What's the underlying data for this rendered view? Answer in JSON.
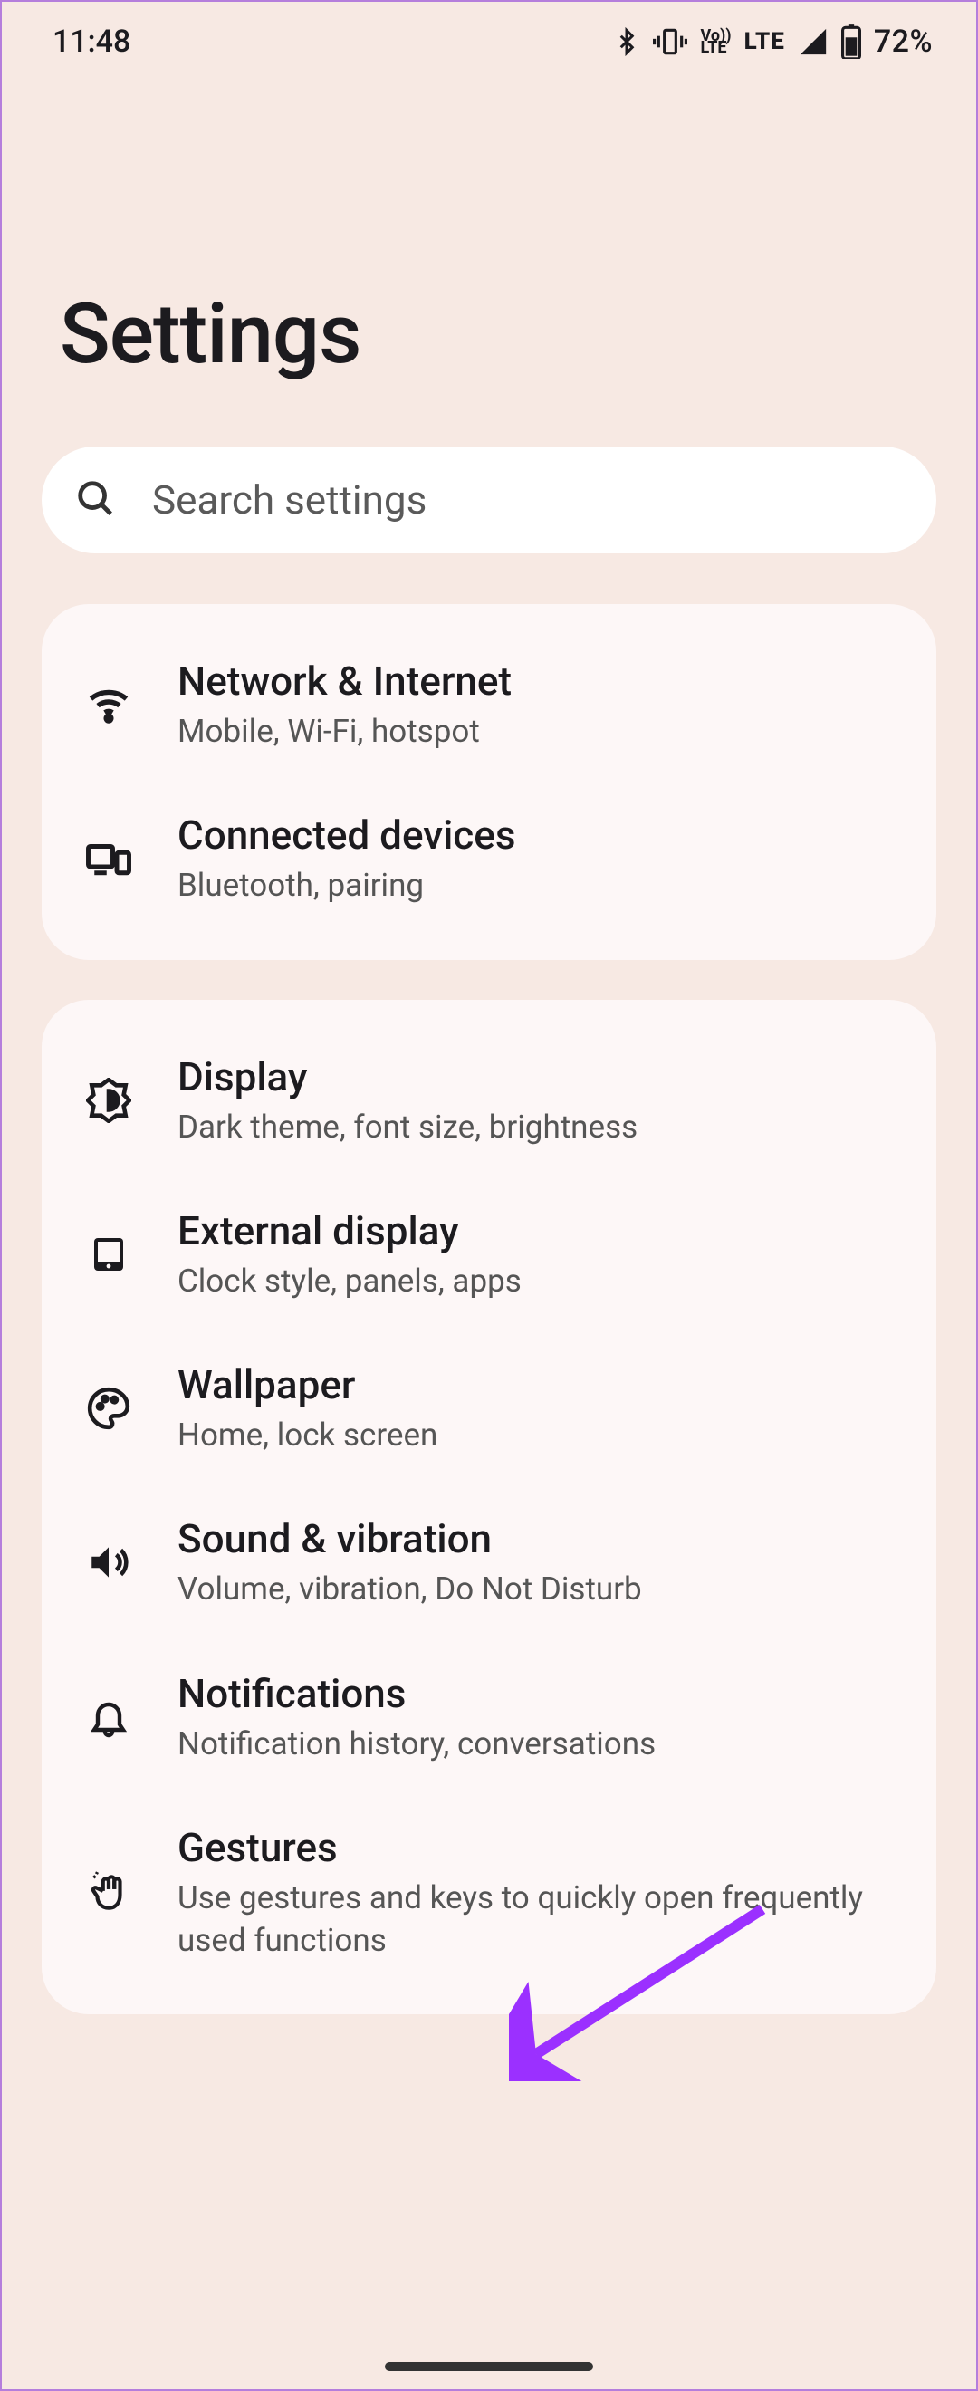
{
  "status": {
    "time": "11:48",
    "battery_pct": "72%",
    "lte": "LTE",
    "volte_top": "Vo))",
    "volte_bot": "LTE"
  },
  "page": {
    "title": "Settings"
  },
  "search": {
    "placeholder": "Search settings"
  },
  "groups": [
    {
      "items": [
        {
          "icon": "wifi",
          "title": "Network & Internet",
          "subtitle": "Mobile, Wi-Fi, hotspot"
        },
        {
          "icon": "devices",
          "title": "Connected devices",
          "subtitle": "Bluetooth, pairing"
        }
      ]
    },
    {
      "items": [
        {
          "icon": "brightness",
          "title": "Display",
          "subtitle": "Dark theme, font size, brightness"
        },
        {
          "icon": "tablet",
          "title": "External display",
          "subtitle": "Clock style, panels, apps"
        },
        {
          "icon": "palette",
          "title": "Wallpaper",
          "subtitle": "Home, lock screen"
        },
        {
          "icon": "volume",
          "title": "Sound & vibration",
          "subtitle": "Volume, vibration, Do Not Disturb"
        },
        {
          "icon": "bell",
          "title": "Notifications",
          "subtitle": "Notification history, conversations"
        },
        {
          "icon": "gesture",
          "title": "Gestures",
          "subtitle": "Use gestures and keys to quickly open frequently used functions"
        }
      ]
    }
  ]
}
